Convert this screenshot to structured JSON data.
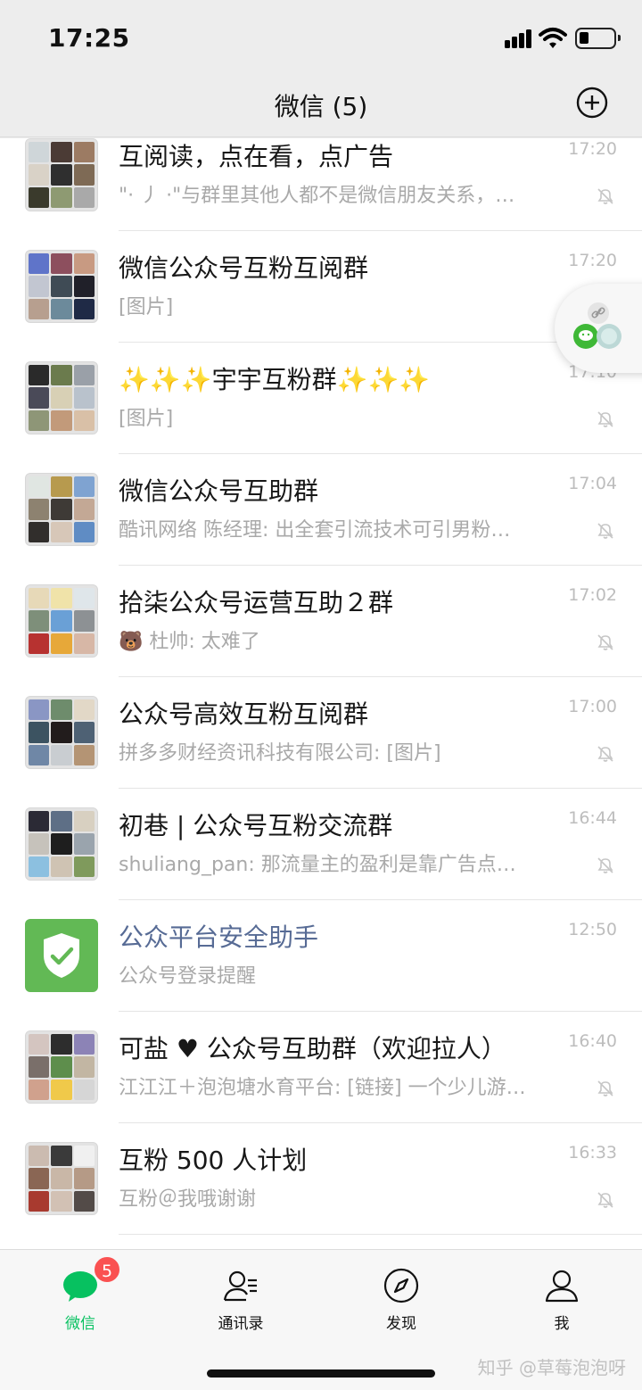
{
  "status_bar": {
    "time": "17:25"
  },
  "nav": {
    "title": "微信 (5)"
  },
  "chats": [
    {
      "name": "互阅读，点在看，点广告",
      "preview": "\"· 丿 ·\"与群里其他人都不是微信朋友关系，…",
      "time": "17:20",
      "muted": true,
      "avatar": "group"
    },
    {
      "name": "微信公众号互粉互阅群",
      "preview": "[图片]",
      "time": "17:20",
      "muted": false,
      "avatar": "group"
    },
    {
      "name": "✨✨✨宇宇互粉群✨✨✨",
      "preview": "[图片]",
      "time": "17:10",
      "muted": true,
      "avatar": "group"
    },
    {
      "name": "微信公众号互助群",
      "preview": "酷讯网络  陈经理: 出全套引流技术可引男粉…",
      "time": "17:04",
      "muted": true,
      "avatar": "group"
    },
    {
      "name": "拾柒公众号运营互助２群",
      "preview": "🐻 杜帅: 太难了",
      "time": "17:02",
      "muted": true,
      "avatar": "group"
    },
    {
      "name": "公众号高效互粉互阅群",
      "preview": "拼多多财经资讯科技有限公司: [图片]",
      "time": "17:00",
      "muted": true,
      "avatar": "group"
    },
    {
      "name": "初巷 | 公众号互粉交流群",
      "preview": "shuliang_pan: 那流量主的盈利是靠广告点…",
      "time": "16:44",
      "muted": true,
      "avatar": "group"
    },
    {
      "name": "公众平台安全助手",
      "preview": "公众号登录提醒",
      "time": "12:50",
      "muted": false,
      "avatar": "shield"
    },
    {
      "name": "可盐 ♥ 公众号互助群（欢迎拉人）",
      "preview": "江江江＋泡泡塘水育平台: [链接] 一个少儿游…",
      "time": "16:40",
      "muted": true,
      "avatar": "group"
    },
    {
      "name": "互粉 500 人计划",
      "preview": "互粉＠我哦谢谢",
      "time": "16:33",
      "muted": true,
      "avatar": "group"
    }
  ],
  "tabs": [
    {
      "label": "微信",
      "icon": "chat-bubble-icon",
      "badge": "5",
      "active": true
    },
    {
      "label": "通讯录",
      "icon": "contacts-icon",
      "active": false
    },
    {
      "label": "发现",
      "icon": "compass-icon",
      "active": false
    },
    {
      "label": "我",
      "icon": "person-icon",
      "active": false
    }
  ],
  "watermark": "知乎 @草莓泡泡呀",
  "colors": {
    "accent": "#07c160",
    "badge": "#fa5151",
    "official_name": "#576b95",
    "shield_bg": "#62b955"
  }
}
